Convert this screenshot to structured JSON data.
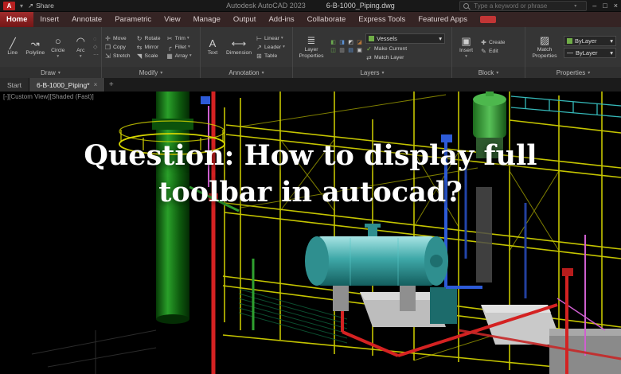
{
  "title_bar": {
    "share": "Share",
    "app_title": "Autodesk AutoCAD 2023",
    "doc_title": "6-B-1000_Piping.dwg",
    "search_placeholder": "Type a keyword or phrase"
  },
  "ribbon": {
    "tabs": [
      "Home",
      "Insert",
      "Annotate",
      "Parametric",
      "View",
      "Manage",
      "Output",
      "Add-ins",
      "Collaborate",
      "Express Tools",
      "Featured Apps"
    ],
    "panels": {
      "draw": {
        "label": "Draw",
        "buttons": [
          "Line",
          "Polyline",
          "Circle",
          "Arc"
        ]
      },
      "modify": {
        "label": "Modify",
        "buttons": [
          "Move",
          "Rotate",
          "Trim",
          "Copy",
          "Mirror",
          "Fillet",
          "Stretch",
          "Scale",
          "Array"
        ]
      },
      "annotation": {
        "label": "Annotation",
        "big": [
          "Text",
          "Dimension"
        ],
        "small": [
          "Linear",
          "Leader",
          "Table"
        ]
      },
      "layers": {
        "label": "Layers",
        "big": "Layer Properties",
        "select": "Vessels",
        "small": [
          "Make Current",
          "Match Layer"
        ]
      },
      "block": {
        "label": "Block",
        "big": "Insert",
        "small": [
          "Create",
          "Edit"
        ]
      },
      "properties": {
        "label": "Properties",
        "big": "Match Properties",
        "bylayer": "ByLayer"
      }
    }
  },
  "file_tabs": {
    "start": "Start",
    "doc": "6-B-1000_Piping*"
  },
  "viewport": {
    "controls": "[-][Custom View][Shaded (Fast)]",
    "overlay_text": "Question: How to display full toolbar in autocad?"
  },
  "icons": {
    "logo": "A",
    "dropdown": "▾",
    "share": "↗",
    "minimize": "–",
    "restore": "□",
    "close": "×",
    "line": "╱",
    "polyline": "↝",
    "circle": "○",
    "arc": "◠",
    "move": "✛",
    "rotate": "↻",
    "trim": "✂",
    "copy": "❐",
    "mirror": "⇆",
    "fillet": "╭",
    "stretch": "⇲",
    "scale": "◥",
    "array": "▦",
    "text": "A",
    "dimension": "⟷",
    "linear": "⊢",
    "leader": "↗",
    "table": "⊞",
    "layer_props": "≣",
    "make_current": "✓",
    "match_layer": "⇄",
    "insert": "▣",
    "create": "✚",
    "edit": "✎",
    "match_props": "▨",
    "line_sample": "—",
    "plus": "+",
    "tab_close": "×",
    "draw_mini": [
      "◌",
      "◇",
      "⋯"
    ],
    "layers_tools": [
      "◧",
      "◨",
      "◩",
      "◪",
      "◫",
      "▥",
      "▤",
      "▣"
    ]
  },
  "colors": {
    "accent_red": "#8e2424",
    "pipe_green": "#2aa02a",
    "structure_yellow": "#d6d600",
    "vessel_teal": "#3fa9a9",
    "vessel_green": "#58c158",
    "pipe_red": "#d42222",
    "pipe_blue": "#2d5bd8",
    "magenta": "#cf5fcf"
  }
}
